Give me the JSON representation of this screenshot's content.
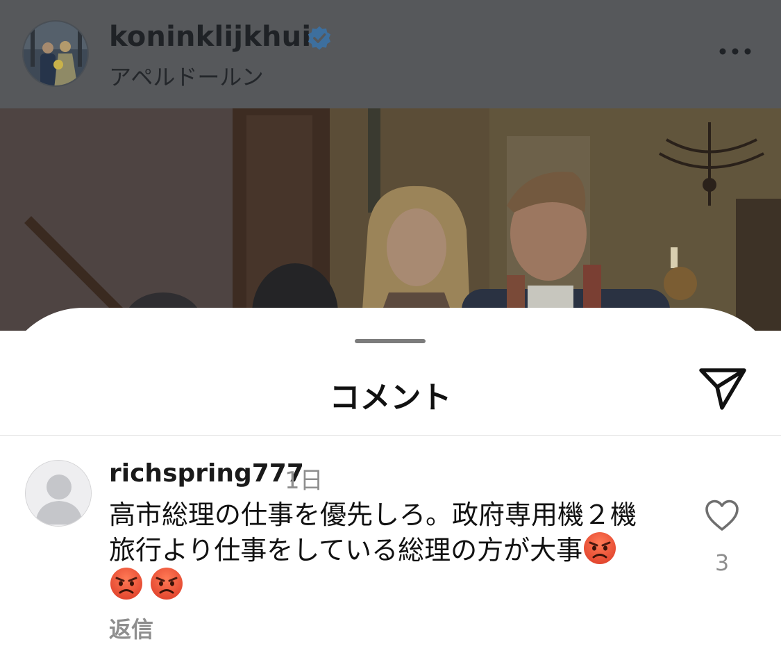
{
  "post": {
    "username": "koninklijkhuis",
    "location": "アペルドールン",
    "verified_icon": "verified-badge-icon",
    "more_icon": "more-options-icon"
  },
  "comments_sheet": {
    "title": "コメント",
    "share_icon": "send-icon"
  },
  "comment": {
    "username": "richspring777",
    "time": "1日",
    "text_line1": "高市総理の仕事を優先しろ。政府専用機２機",
    "text_line2": "旅行より仕事をしている総理の方が大事",
    "emoji": "angry-face-emoji",
    "emoji_count": 3,
    "reply_label": "返信",
    "like_icon": "heart-icon",
    "like_count": "3"
  },
  "colors": {
    "header_dim": "#56585b",
    "verified_blue": "#3d6f9e",
    "muted_text": "#8e8e8e",
    "emoji_red": "#e2452e"
  }
}
